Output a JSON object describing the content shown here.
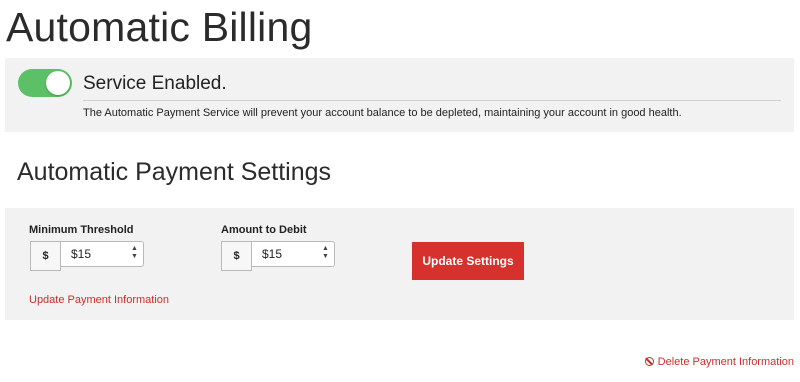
{
  "page": {
    "title": "Automatic Billing"
  },
  "service": {
    "enabled": true,
    "status_label": "Service Enabled.",
    "description": "The Automatic Payment Service will prevent your account balance to be depleted, maintaining your account in good health.",
    "toggle_color": "#5cc166"
  },
  "settings": {
    "section_title": "Automatic Payment Settings",
    "minimum_threshold": {
      "label": "Minimum Threshold",
      "currency_symbol": "$",
      "selected_value": "$15"
    },
    "amount_to_debit": {
      "label": "Amount to Debit",
      "currency_symbol": "$",
      "selected_value": "$15"
    },
    "update_button_label": "Update Settings",
    "update_payment_link": "Update Payment Information",
    "button_color": "#d6312c"
  },
  "footer": {
    "delete_payment_link": "Delete Payment Information",
    "delete_icon": "ban-icon"
  }
}
